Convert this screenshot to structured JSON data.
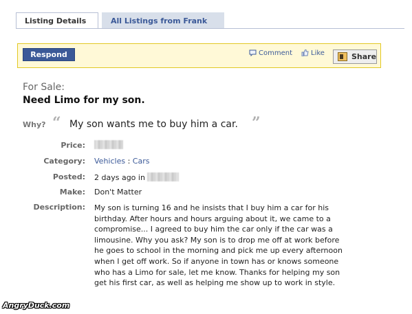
{
  "tabs": {
    "active_label": "Listing Details",
    "inactive_label": "All Listings from Frank"
  },
  "actions": {
    "respond_label": "Respond",
    "comment_label": "Comment",
    "like_label": "Like",
    "share_label": "Share"
  },
  "listing": {
    "for_sale_label": "For Sale:",
    "title": "Need Limo for my son.",
    "why_label": "Why?",
    "why_text": "My son wants me to buy him a car.",
    "fields": {
      "price_label": "Price:",
      "category_label": "Category:",
      "category_link": "Vehicles",
      "category_sep": " : ",
      "category_value": "Cars",
      "posted_label": "Posted:",
      "posted_value": "2 days ago in",
      "make_label": "Make:",
      "make_value": "Don't Matter",
      "description_label": "Description:"
    },
    "description_lines": [
      "My son is turning 16 and he insists that I buy him a car for his",
      "birthday. After hours and hours arguing about it, we came to a",
      "compromise... I agreed to buy him the car only if the car was a",
      "limousine. Why you ask? My son is to drop me off at work before",
      "he goes to school in the morning and pick me up every afternoon",
      "when I get off work. So if anyone in town has or knows someone",
      "who has a Limo for sale, let me know. Thanks for helping my son",
      "get his first car, as well as helping me show up to work in style."
    ]
  },
  "watermark": "AngryDuck.com",
  "colors": {
    "link_blue": "#3b5998",
    "bar_yellow": "#fff9d7",
    "bar_border": "#e2c822"
  },
  "icons": [
    "comment-icon",
    "like-icon",
    "share-icon"
  ]
}
